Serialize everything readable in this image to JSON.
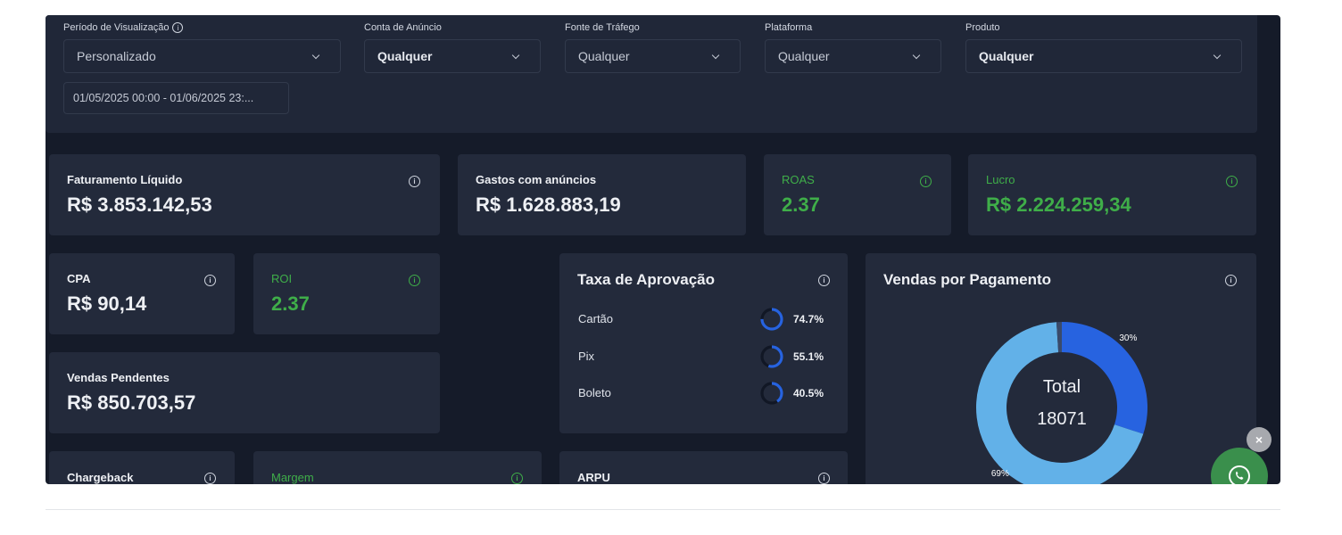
{
  "filters": {
    "periodo": {
      "label": "Período de Visualização",
      "value": "Personalizado"
    },
    "date_range": "01/05/2025 00:00 - 01/06/2025 23:...",
    "conta": {
      "label": "Conta de Anúncio",
      "value": "Qualquer"
    },
    "fonte": {
      "label": "Fonte de Tráfego",
      "value": "Qualquer"
    },
    "plataforma": {
      "label": "Plataforma",
      "value": "Qualquer"
    },
    "produto": {
      "label": "Produto",
      "value": "Qualquer"
    }
  },
  "cards": {
    "faturamento": {
      "label": "Faturamento Líquido",
      "value": "R$ 3.853.142,53"
    },
    "gastos": {
      "label": "Gastos com anúncios",
      "value": "R$ 1.628.883,19"
    },
    "roas": {
      "label": "ROAS",
      "value": "2.37"
    },
    "lucro": {
      "label": "Lucro",
      "value": "R$ 2.224.259,34"
    },
    "cpa": {
      "label": "CPA",
      "value": "R$ 90,14"
    },
    "roi": {
      "label": "ROI",
      "value": "2.37"
    },
    "pendentes": {
      "label": "Vendas Pendentes",
      "value": "R$ 850.703,57"
    },
    "chargeback": {
      "label": "Chargeback"
    },
    "margem": {
      "label": "Margem"
    },
    "arpu": {
      "label": "ARPU"
    }
  },
  "aprovacao": {
    "title": "Taxa de Aprovação",
    "rows": [
      {
        "name": "Cartão",
        "value": "74.7%",
        "fraction": 0.747
      },
      {
        "name": "Pix",
        "value": "55.1%",
        "fraction": 0.551
      },
      {
        "name": "Boleto",
        "value": "40.5%",
        "fraction": 0.405
      }
    ]
  },
  "pagamento": {
    "title": "Vendas por Pagamento",
    "total_label": "Total",
    "total_value": "18071"
  },
  "chart_data": {
    "type": "pie",
    "title": "Vendas por Pagamento",
    "slices": [
      {
        "label": "30%",
        "value": 30,
        "color": "#2763e0"
      },
      {
        "label": "69%",
        "value": 69,
        "color": "#62b1e8"
      },
      {
        "label": "",
        "value": 1,
        "color": "#3a4a6a"
      }
    ]
  },
  "colors": {
    "background": "#151b29",
    "card": "#232a3b",
    "accent_green": "#3fae49",
    "ring_blue": "#2763e0"
  },
  "icons": {
    "info": "info-icon",
    "chevron": "chevron-down-icon",
    "close": "close-icon",
    "whatsapp": "whatsapp-icon"
  },
  "close_symbol": "×"
}
